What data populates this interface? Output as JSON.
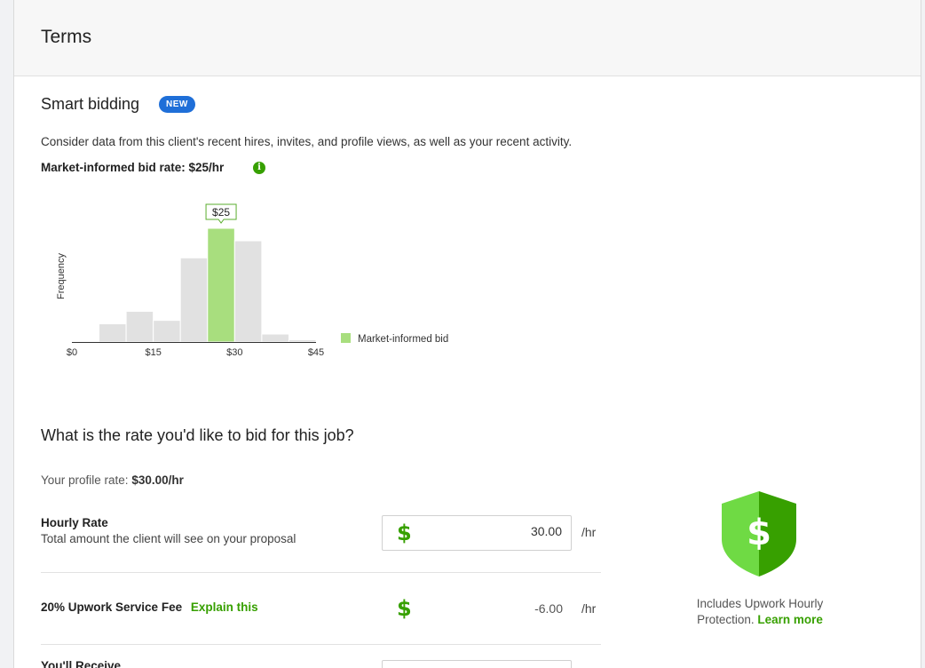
{
  "header": {
    "title": "Terms"
  },
  "smart_bidding": {
    "title": "Smart bidding",
    "badge": "NEW",
    "description": "Consider data from this client's recent hires, invites, and profile views, as well as your recent activity.",
    "market_rate_label": "Market-informed bid rate: $25/hr",
    "info_icon": "info-icon",
    "tooltip": "$25"
  },
  "chart_data": {
    "type": "bar",
    "ylabel": "Frequency",
    "x_ticks": [
      "$0",
      "$15",
      "$30",
      "$45"
    ],
    "x_tick_values": [
      0,
      15,
      30,
      45
    ],
    "bin_edges": [
      0,
      5,
      10,
      15,
      20,
      25,
      30,
      35,
      40,
      45
    ],
    "values": [
      0,
      16,
      27,
      19,
      74,
      100,
      89,
      7,
      2,
      1
    ],
    "highlight_bin": 5,
    "highlight_color": "#a8de7e",
    "bar_color": "#e1e1e1",
    "ylim": [
      0,
      100
    ],
    "legend": [
      {
        "name": "Market-informed bid",
        "color": "#a8de7e"
      }
    ],
    "legend_position": "right"
  },
  "bid": {
    "question": "What is the rate you'd like to bid for this job?",
    "profile_rate_prefix": "Your profile rate: ",
    "profile_rate_value": "$30.00/hr",
    "hourly": {
      "label": "Hourly Rate",
      "sub": "Total amount the client will see on your proposal",
      "currency": "$",
      "value": "30.00",
      "unit": "/hr"
    },
    "fee": {
      "label": "20% Upwork Service Fee",
      "link": "Explain this",
      "currency": "$",
      "value": "-6.00",
      "unit": "/hr"
    },
    "receive": {
      "label": "You'll Receive"
    }
  },
  "protection": {
    "icon": "shield-dollar-icon",
    "icon_symbol": "$",
    "text": "Includes Upwork Hourly Protection.",
    "link": "Learn more",
    "colors": {
      "light": "#6fda44",
      "dark": "#37a000"
    }
  }
}
